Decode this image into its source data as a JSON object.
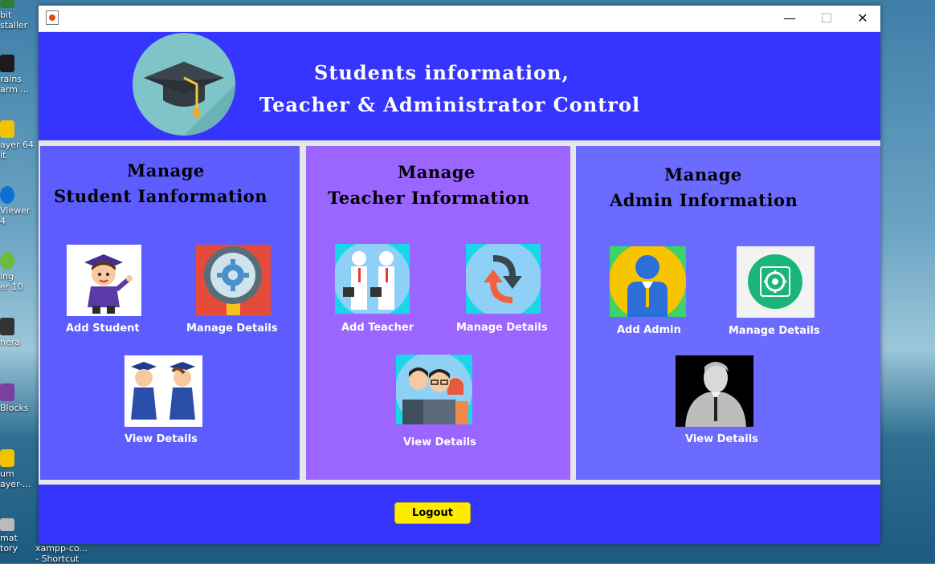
{
  "desktop": {
    "icons": [
      {
        "label": "bit\nstaller",
        "color": "#2e7d32"
      },
      {
        "label": "rains\narm ...",
        "color": "#1b1b1b"
      },
      {
        "label": "ayer 64\nit",
        "color": "#f2c200"
      },
      {
        "label": "Viewer\n4",
        "color": "#0e6fd6"
      },
      {
        "label": "ing\ner 10",
        "color": "#6dbb3a"
      },
      {
        "label": "nera",
        "color": "#333333"
      },
      {
        "label": "Blocks",
        "color": "#7b3fa0"
      },
      {
        "label": "um\nayer-...",
        "color": "#f2c200"
      },
      {
        "label": "mat\ntory",
        "color": "#bbbbbb"
      }
    ],
    "shortcut_label": "xampp-co...\n- Shortcut"
  },
  "window": {
    "controls": {
      "minimize": "—",
      "maximize": "☐",
      "close": "✕"
    }
  },
  "header": {
    "title_line1": "Students information,",
    "title_line2": "Teacher & Administrator Control",
    "logo_icon": "graduation-cap-icon"
  },
  "student_panel": {
    "title_line1": "Manage",
    "title_line2": "Student Ianformation",
    "add_label": "Add Student",
    "manage_label": "Manage Details",
    "view_label": "View Details"
  },
  "teacher_panel": {
    "title_line1": "Manage",
    "title_line2": "Teacher Information",
    "add_label": "Add Teacher",
    "manage_label": "Manage Details",
    "view_label": "View Details"
  },
  "admin_panel": {
    "title_line1": "Manage",
    "title_line2": "Admin Information",
    "add_label": "Add Admin",
    "manage_label": "Manage Details",
    "view_label": "View Details"
  },
  "footer": {
    "logout_label": "Logout"
  },
  "colors": {
    "header_bg": "#3535ff",
    "student_bg": "#5c5cff",
    "teacher_bg": "#9b65ff",
    "admin_bg": "#6b6bff",
    "logout_bg": "#ffeb00"
  }
}
